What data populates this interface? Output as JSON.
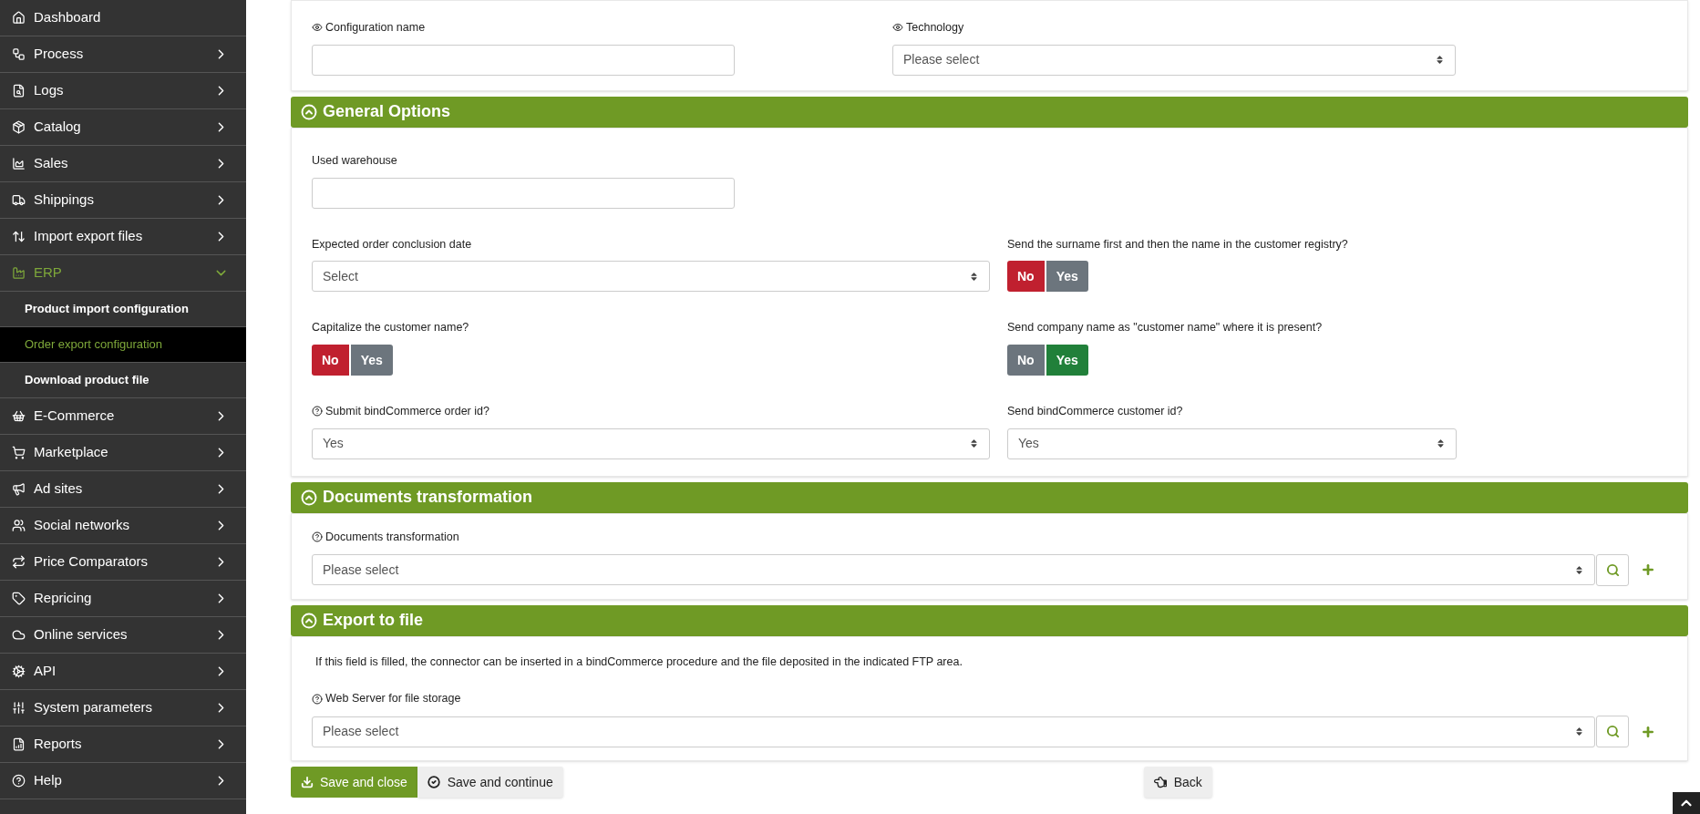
{
  "sidebar": {
    "items": [
      {
        "label": "Dashboard",
        "selected": false
      },
      {
        "label": "Process",
        "selected": false,
        "expanded": false
      },
      {
        "label": "Logs",
        "selected": false,
        "expanded": false
      },
      {
        "label": "Catalog",
        "selected": false,
        "expanded": false
      },
      {
        "label": "Sales",
        "selected": false,
        "expanded": false
      },
      {
        "label": "Shippings",
        "selected": false,
        "expanded": false
      },
      {
        "label": "Import export files",
        "selected": false,
        "expanded": false
      },
      {
        "label": "ERP",
        "selected": true,
        "expanded": true,
        "children": [
          {
            "label": "Product import configuration",
            "selected": false
          },
          {
            "label": "Order export configuration",
            "selected": true
          },
          {
            "label": "Download product file",
            "selected": false
          }
        ]
      },
      {
        "label": "E-Commerce",
        "selected": false,
        "expanded": false
      },
      {
        "label": "Marketplace",
        "selected": false,
        "expanded": false
      },
      {
        "label": "Ad sites",
        "selected": false,
        "expanded": false
      },
      {
        "label": "Social networks",
        "selected": false,
        "expanded": false
      },
      {
        "label": "Price Comparators",
        "selected": false,
        "expanded": false
      },
      {
        "label": "Repricing",
        "selected": false,
        "expanded": false
      },
      {
        "label": "Online services",
        "selected": false,
        "expanded": false
      },
      {
        "label": "API",
        "selected": false,
        "expanded": false
      },
      {
        "label": "System parameters",
        "selected": false,
        "expanded": false
      },
      {
        "label": "Reports",
        "selected": false,
        "expanded": false
      },
      {
        "label": "Help",
        "selected": false,
        "expanded": false
      }
    ]
  },
  "sections": [
    {
      "kind": "basic",
      "rows": [
        [
          {
            "kind": "text",
            "label": "Configuration name",
            "visible": true,
            "hint": false
          },
          {
            "kind": "select",
            "label": "Technology",
            "visible": true,
            "hint": false,
            "value": "Please select"
          }
        ]
      ]
    },
    {
      "kind": "options",
      "title": "General Options",
      "expanded": true,
      "rows": [
        [
          {
            "kind": "text",
            "label": "Used warehouse",
            "visible": false,
            "hint": false
          }
        ],
        [
          {
            "kind": "select",
            "label": "Expected order conclusion date",
            "visible": false,
            "hint": false,
            "value": "Select"
          },
          {
            "kind": "toggle",
            "label": "Send the surname first and then the name in the customer registry?",
            "visible": false,
            "hint": false,
            "options": [
              {
                "label": "No",
                "selected": true
              },
              {
                "label": "Yes",
                "selected": false
              }
            ]
          }
        ],
        [
          {
            "kind": "toggle",
            "label": "Capitalize the customer name?",
            "visible": false,
            "hint": false,
            "options": [
              {
                "label": "No",
                "selected": true
              },
              {
                "label": "Yes",
                "selected": false
              }
            ]
          },
          {
            "kind": "toggle",
            "label": "Send company name as \"customer name\" where it is present?",
            "visible": false,
            "hint": false,
            "options": [
              {
                "label": "No",
                "selected": false
              },
              {
                "label": "Yes",
                "selected": true
              }
            ]
          }
        ],
        [
          {
            "kind": "select",
            "label": "Submit bindCommerce order id?",
            "visible": false,
            "hint": true,
            "value": "Yes"
          },
          {
            "kind": "select",
            "label": "Send bindCommerce customer id?",
            "visible": false,
            "hint": false,
            "value": "Yes"
          }
        ]
      ]
    },
    {
      "kind": "lookup",
      "title": "Documents transformation",
      "expanded": true,
      "rows": [
        [
          {
            "kind": "lookup",
            "label": "Documents transformation",
            "visible": false,
            "hint": true,
            "value": "Please select"
          }
        ]
      ]
    },
    {
      "kind": "lookup",
      "title": "Export to file",
      "expanded": true,
      "note": "If this field is filled, the connector can be inserted in a bindCommerce procedure and the file deposited in the indicated FTP area.",
      "rows": [
        [
          {
            "kind": "lookup",
            "label": "Web Server for file storage",
            "visible": false,
            "hint": true,
            "value": "Please select"
          }
        ]
      ]
    }
  ],
  "actions": [
    {
      "label": "Save and close",
      "kind": "primary"
    },
    {
      "label": "Save and continue",
      "kind": "secondary"
    },
    {
      "label": "Back",
      "kind": "back"
    }
  ]
}
